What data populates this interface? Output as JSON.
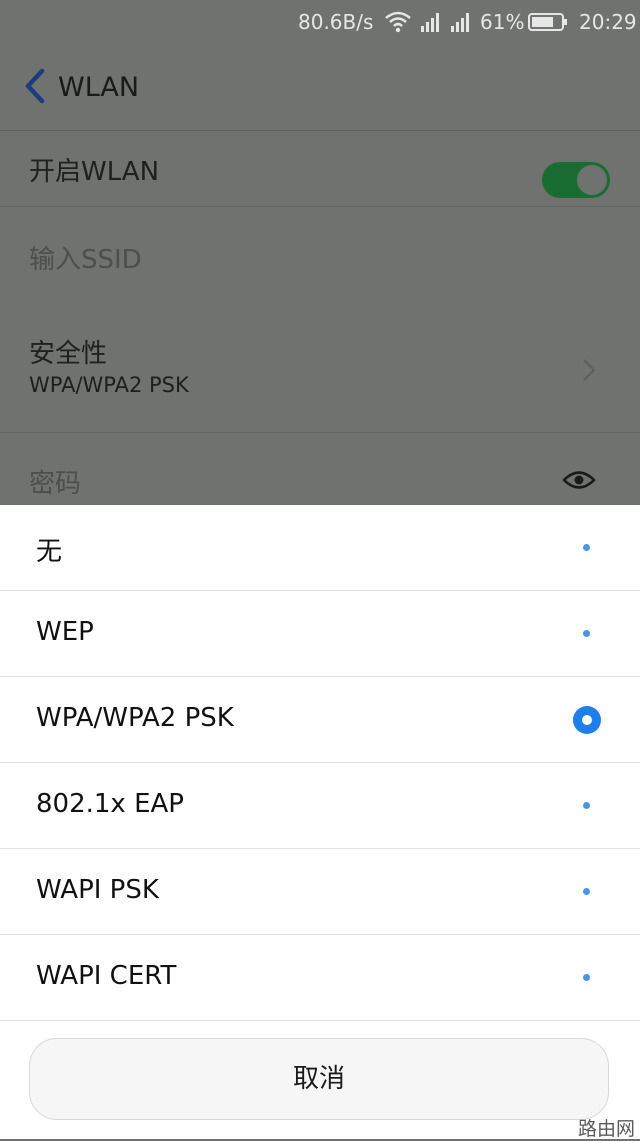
{
  "status_bar": {
    "speed": "80.6B/s",
    "battery_percent": "61%",
    "time": "20:29"
  },
  "header": {
    "title": "WLAN"
  },
  "settings": {
    "enable_wlan_label": "开启WLAN",
    "enable_wlan_on": true,
    "ssid_placeholder": "输入SSID",
    "security_label": "安全性",
    "security_value": "WPA/WPA2 PSK",
    "password_placeholder": "密码"
  },
  "security_sheet": {
    "options": [
      {
        "label": "无",
        "selected": false
      },
      {
        "label": "WEP",
        "selected": false
      },
      {
        "label": "WPA/WPA2 PSK",
        "selected": true
      },
      {
        "label": "802.1x EAP",
        "selected": false
      },
      {
        "label": "WAPI PSK",
        "selected": false
      },
      {
        "label": "WAPI CERT",
        "selected": false
      }
    ],
    "cancel_label": "取消"
  },
  "watermark": "路由网",
  "colors": {
    "accent_blue": "#1e7fea",
    "toggle_green": "#1a6d32",
    "dim_overlay": "#6f726f"
  }
}
